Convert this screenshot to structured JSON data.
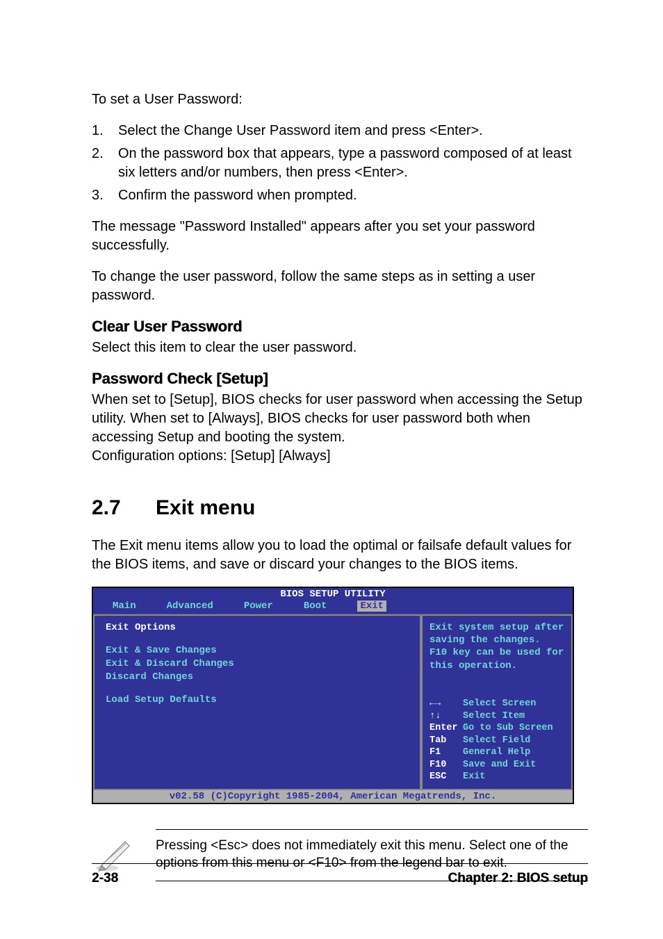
{
  "intro": {
    "title": "To set a User Password:",
    "steps": [
      "Select the Change User Password item and press <Enter>.",
      "On the password box that appears, type a password composed of at least six letters and/or numbers, then press <Enter>.",
      "Confirm the password when prompted."
    ],
    "after1": "The message \"Password Installed\" appears after you set your password successfully.",
    "after2": "To change the user password, follow the same steps as in setting a user password."
  },
  "clear": {
    "heading": "Clear User Password",
    "body": "Select this item to clear the user password."
  },
  "check": {
    "heading": "Password Check [Setup]",
    "body1": "When set to [Setup], BIOS checks for user password when accessing the Setup utility. When set to [Always], BIOS checks for user password both when accessing Setup and booting the system.",
    "body2": "Configuration options: [Setup] [Always]"
  },
  "section": {
    "num": "2.7",
    "title": "Exit menu",
    "lead": "The Exit menu items allow you to load the optimal or failsafe default values for the BIOS items, and save or discard your changes to the BIOS items."
  },
  "bios": {
    "title": "BIOS SETUP UTILITY",
    "tabs": [
      "Main",
      "Advanced",
      "Power",
      "Boot",
      "Exit"
    ],
    "selectedTab": "Exit",
    "left": {
      "header": "Exit Options",
      "items": [
        "Exit & Save Changes",
        "Exit & Discard Changes",
        "Discard Changes",
        "",
        "Load Setup Defaults"
      ]
    },
    "helpTop": "Exit system setup after saving the changes.\nF10 key can be used for this operation.",
    "keys": [
      {
        "k": "←→",
        "d": "Select Screen"
      },
      {
        "k": "↑↓",
        "d": "Select Item"
      },
      {
        "k": "Enter",
        "d": "Go to Sub Screen"
      },
      {
        "k": "Tab",
        "d": "Select Field"
      },
      {
        "k": "F1",
        "d": "General Help"
      },
      {
        "k": "F10",
        "d": "Save and Exit"
      },
      {
        "k": "ESC",
        "d": "Exit"
      }
    ],
    "footer": "v02.58 (C)Copyright 1985-2004, American Megatrends, Inc."
  },
  "note": "Pressing <Esc> does not immediately exit this menu. Select one of the options from this menu or <F10> from the legend bar to exit.",
  "pageFooter": {
    "left": "2-38",
    "right": "Chapter 2: BIOS setup"
  }
}
